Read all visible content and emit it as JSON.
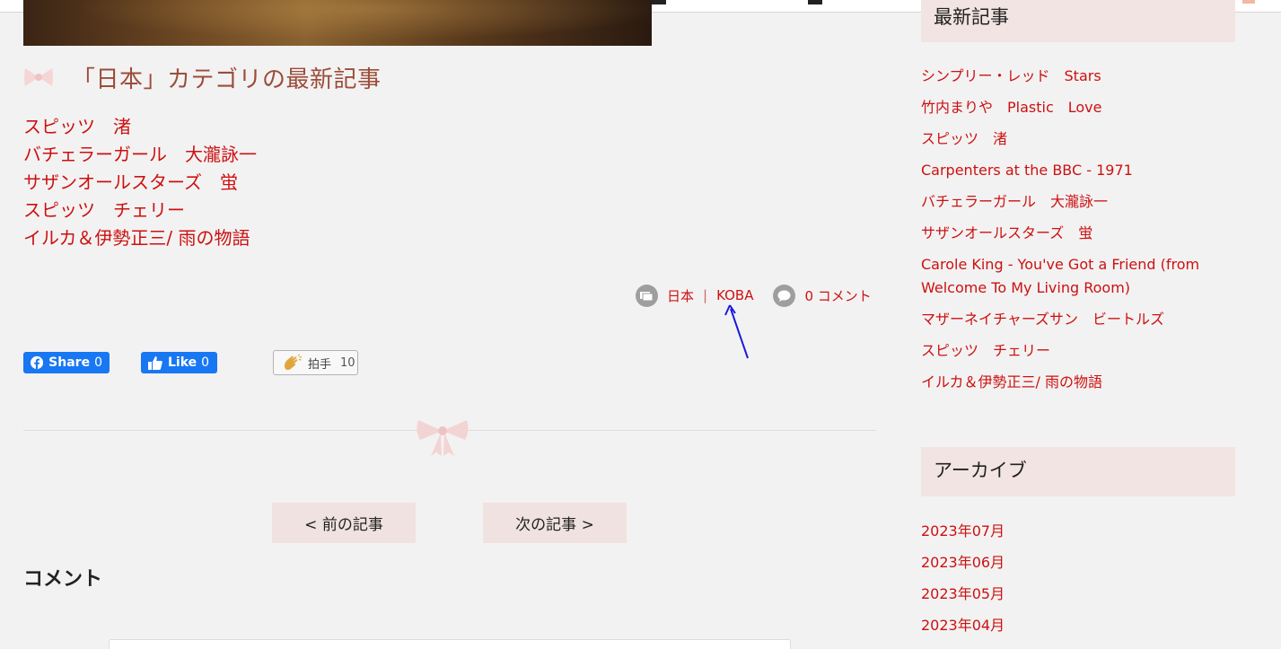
{
  "colors": {
    "link": "#cc1111",
    "heading_brown": "#9b4d3a",
    "sidebar_header_bg": "#f2e4e2",
    "pager_bg": "#f0e2e0",
    "facebook_blue": "#1877f2",
    "annotation_arrow": "#1a1adb"
  },
  "main": {
    "category_heading": "「日本」カテゴリの最新記事",
    "category_articles": [
      "スピッツ　渚",
      "バチェラーガール　大瀧詠一",
      "サザンオールスターズ　蛍",
      "スピッツ　チェリー",
      "イルカ＆伊勢正三/ 雨の物語"
    ],
    "meta": {
      "category_icon": "folder-icon",
      "category": "日本",
      "author": "KOBA",
      "comment_icon": "speech-bubble-icon",
      "comments": "0 コメント"
    },
    "share": {
      "fb_share_label": "Share",
      "fb_share_count": "0",
      "fb_like_label": "Like",
      "fb_like_count": "0",
      "clap_label": "拍手",
      "clap_count": "10"
    },
    "pager": {
      "prev": "< 前の記事",
      "next": "次の記事 >"
    },
    "comments_heading": "コメント"
  },
  "sidebar": {
    "recent_title": "最新記事",
    "recent_items": [
      "シンプリー・レッド　Stars",
      "竹内まりや　Plastic　Love",
      "スピッツ　渚",
      "Carpenters at the BBC - 1971",
      "バチェラーガール　大瀧詠一",
      "サザンオールスターズ　蛍",
      "Carole King - You've Got a Friend (from Welcome To My Living Room)",
      "マザーネイチャーズサン　ビートルズ",
      "スピッツ　チェリー",
      "イルカ＆伊勢正三/ 雨の物語"
    ],
    "archive_title": "アーカイブ",
    "archive_items": [
      "2023年07月",
      "2023年06月",
      "2023年05月",
      "2023年04月"
    ]
  }
}
